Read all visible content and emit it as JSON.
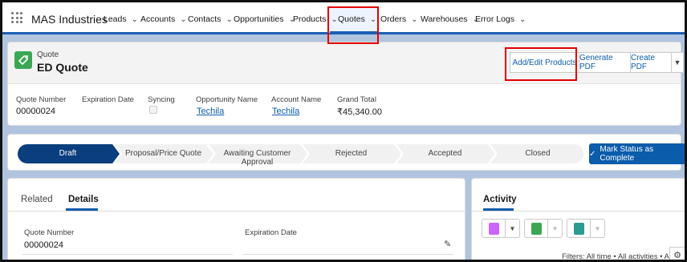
{
  "nav": {
    "app_name": "MAS Industries",
    "items": [
      {
        "label": "Leads"
      },
      {
        "label": "Accounts"
      },
      {
        "label": "Contacts"
      },
      {
        "label": "Opportunities"
      },
      {
        "label": "Products"
      },
      {
        "label": "Quotes"
      },
      {
        "label": "Orders"
      },
      {
        "label": "Warehouses"
      },
      {
        "label": "Error Logs"
      }
    ],
    "selected": "Quotes"
  },
  "record": {
    "object_label": "Quote",
    "title": "ED Quote",
    "actions": [
      "Add/Edit Products",
      "Generate PDF",
      "Create PDF"
    ]
  },
  "highlights": {
    "quote_number_label": "Quote Number",
    "quote_number": "00000024",
    "expiration_label": "Expiration Date",
    "syncing_label": "Syncing",
    "opportunity_label": "Opportunity Name",
    "opportunity": "Techila",
    "account_label": "Account Name",
    "account": "Techila",
    "grand_total_label": "Grand Total",
    "grand_total": "₹45,340.00"
  },
  "path": {
    "stages": [
      "Draft",
      "Proposal/Price Quote",
      "Awaiting Customer Approval",
      "Rejected",
      "Accepted",
      "Closed"
    ],
    "current": "Draft",
    "mark_button": "Mark Status as Complete"
  },
  "details": {
    "tabs": [
      "Related",
      "Details"
    ],
    "active_tab": "Details",
    "quote_number_label": "Quote Number",
    "quote_number": "00000024",
    "expiration_label": "Expiration Date"
  },
  "activity": {
    "title": "Activity",
    "filters": "Filters: All time • All activities • All types"
  },
  "colors": {
    "brand": "#0b5cab",
    "path_active": "#0b3e7e",
    "highlight_box": "#e30000",
    "quote_icon": "#3ba755"
  }
}
